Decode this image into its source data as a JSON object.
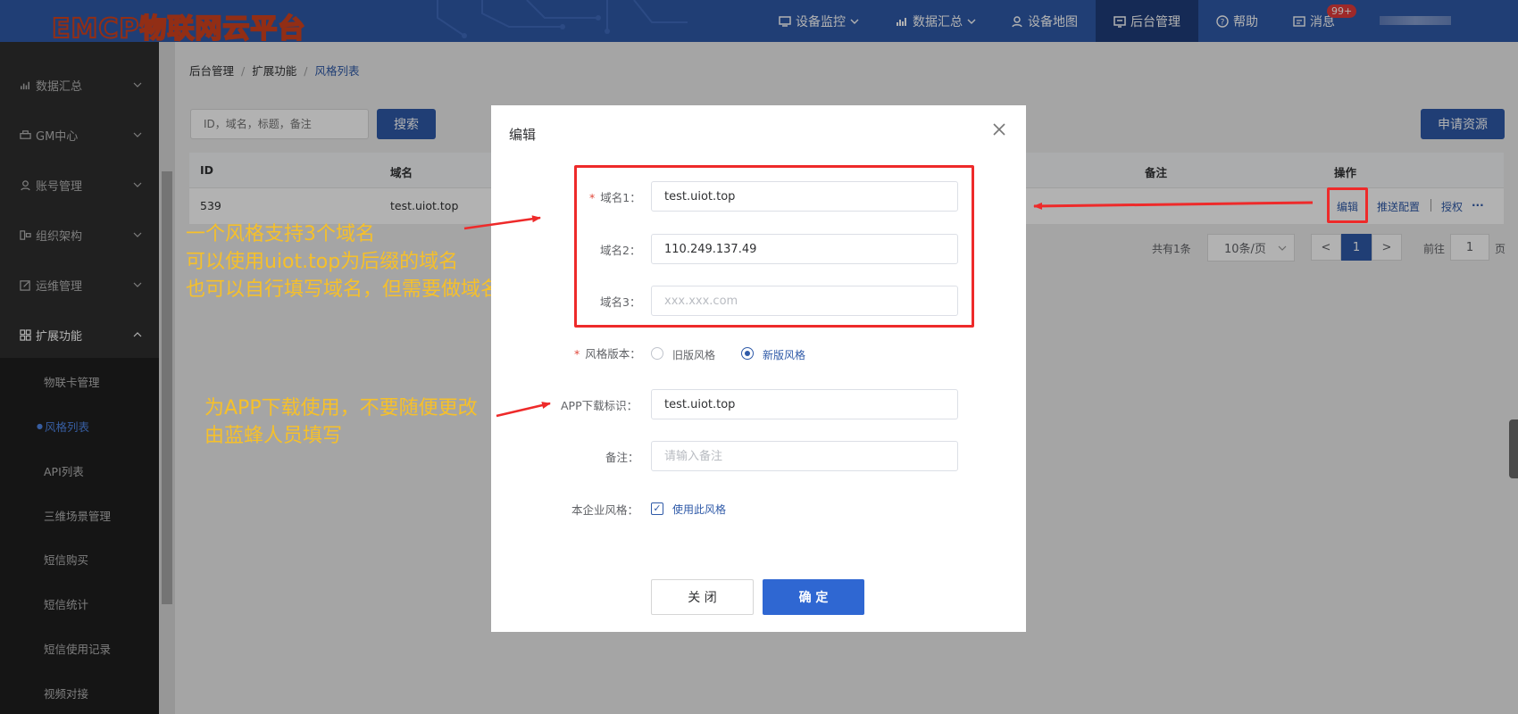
{
  "header": {
    "logo_text": "EMCP物联网云平台",
    "nav": [
      {
        "label": "设备监控",
        "icon": "monitor-icon",
        "has_dropdown": true
      },
      {
        "label": "数据汇总",
        "icon": "bar-chart-icon",
        "has_dropdown": true
      },
      {
        "label": "设备地图",
        "icon": "location-icon",
        "has_dropdown": false
      },
      {
        "label": "后台管理",
        "icon": "admin-icon",
        "has_dropdown": false,
        "active": true
      },
      {
        "label": "帮助",
        "icon": "help-icon",
        "has_dropdown": false
      },
      {
        "label": "消息",
        "icon": "message-icon",
        "has_dropdown": false
      }
    ],
    "message_badge": "99+"
  },
  "sidebar": {
    "items": [
      {
        "label": "数据汇总",
        "icon": "bar-chart-icon"
      },
      {
        "label": "GM中心",
        "icon": "printer-icon"
      },
      {
        "label": "账号管理",
        "icon": "user-icon"
      },
      {
        "label": "组织架构",
        "icon": "org-icon"
      },
      {
        "label": "运维管理",
        "icon": "edit-icon"
      },
      {
        "label": "扩展功能",
        "icon": "grid-icon",
        "expanded": true
      }
    ],
    "subitems": [
      {
        "label": "物联卡管理"
      },
      {
        "label": "风格列表",
        "active": true
      },
      {
        "label": "API列表"
      },
      {
        "label": "三维场景管理"
      },
      {
        "label": "短信购买"
      },
      {
        "label": "短信统计"
      },
      {
        "label": "短信使用记录"
      },
      {
        "label": "视频对接"
      }
    ]
  },
  "breadcrumb": [
    "后台管理",
    "扩展功能",
    "风格列表"
  ],
  "toolbar": {
    "search_placeholder": "ID，域名，标题，备注",
    "search_button": "搜索",
    "apply_button": "申请资源"
  },
  "table": {
    "headers": {
      "id": "ID",
      "domain": "域名",
      "remark": "备注",
      "actions": "操作"
    },
    "rows": [
      {
        "id": "539",
        "domain": "test.uiot.top"
      }
    ],
    "row_actions": [
      "编辑",
      "推送配置",
      "授权",
      "···"
    ]
  },
  "pagination": {
    "total_text": "共有1条",
    "page_size": "10条/页",
    "prev": "<",
    "current_page": "1",
    "next": ">",
    "goto_label": "前往",
    "goto_value": "1",
    "page_suffix": "页"
  },
  "annotations": {
    "domain_note": [
      "一个风格支持3个域名",
      "可以使用uiot.top为后缀的域名",
      "也可以自行填写域名，但需要做域名解析"
    ],
    "app_note": [
      "为APP下载使用，不要随便更改",
      "由蓝蜂人员填写"
    ]
  },
  "dialog": {
    "title": "编辑",
    "fields": {
      "domain1": {
        "label": "域名1：",
        "value": "test.uiot.top",
        "required": true
      },
      "domain2": {
        "label": "域名2：",
        "value": "110.249.137.49"
      },
      "domain3": {
        "label": "域名3：",
        "value": "",
        "placeholder": "xxx.xxx.com"
      },
      "style_version": {
        "label": "风格版本：",
        "required": true,
        "options": [
          "旧版风格",
          "新版风格"
        ],
        "selected": "新版风格"
      },
      "app_id": {
        "label": "APP下载标识：",
        "value": "test.uiot.top"
      },
      "remark": {
        "label": "备注：",
        "value": "",
        "placeholder": "请输入备注"
      },
      "use_style": {
        "label": "本企业风格：",
        "checkbox_label": "使用此风格",
        "checked": true
      }
    },
    "close_button": "关 闭",
    "ok_button": "确 定"
  },
  "colors": {
    "primary": "#2f5aa8",
    "annotation": "#f6c02a",
    "highlight": "#ee2a2a"
  }
}
